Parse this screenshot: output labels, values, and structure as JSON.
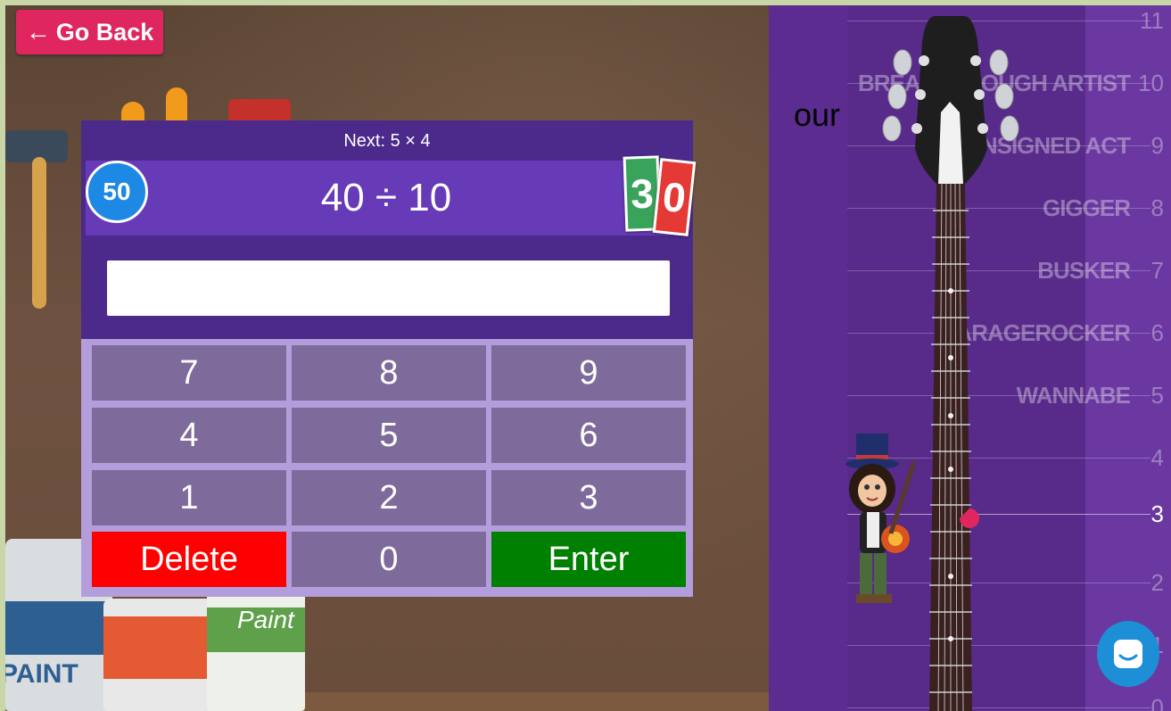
{
  "nav": {
    "back_label": "Go Back",
    "back_icon": "left-arrow-icon"
  },
  "quiz": {
    "next_label": "Next: 5 × 4",
    "question": "40 ÷ 10",
    "timer_value": "50",
    "score_digits": [
      "3",
      "0"
    ],
    "answer_value": "",
    "keys": [
      [
        "7",
        "8",
        "9"
      ],
      [
        "4",
        "5",
        "6"
      ],
      [
        "1",
        "2",
        "3"
      ],
      [
        "Delete",
        "0",
        "Enter"
      ]
    ]
  },
  "ladder": {
    "levels": [
      {
        "num": "11",
        "name": ""
      },
      {
        "num": "10",
        "name": "BREAKTHROUGH ARTIST"
      },
      {
        "num": "9",
        "name": "UNSIGNED ACT"
      },
      {
        "num": "8",
        "name": "GIGGER"
      },
      {
        "num": "7",
        "name": "BUSKER"
      },
      {
        "num": "6",
        "name": "GARAGEROCKER"
      },
      {
        "num": "5",
        "name": "WANNABE"
      },
      {
        "num": "4",
        "name": ""
      },
      {
        "num": "3",
        "name": ""
      },
      {
        "num": "2",
        "name": ""
      },
      {
        "num": "1",
        "name": ""
      },
      {
        "num": "0",
        "name": ""
      }
    ],
    "current_level": "3",
    "overlay_text": "our"
  },
  "scene": {
    "paint_can_labels": [
      "PAINT",
      "Paint"
    ]
  },
  "colors": {
    "back_button": "#e0265e",
    "panel": "#4b2a8c",
    "question_bar": "#673ab7",
    "keypad": "#b39ddb",
    "key": "#7e6b9b",
    "delete": "#ff0000",
    "enter": "#008000",
    "ladder": "#5c2c90",
    "chat": "#1c8fd6",
    "marker": "#e0265e"
  }
}
